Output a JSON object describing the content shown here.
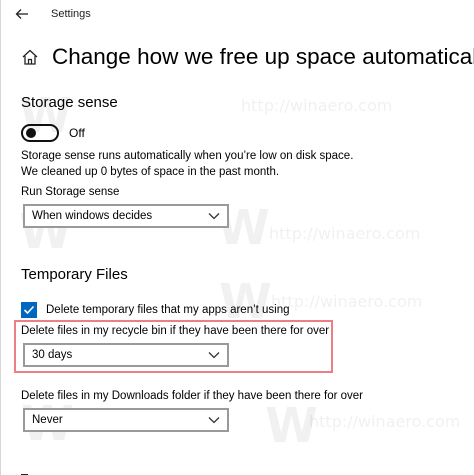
{
  "window": {
    "app_title": "Settings"
  },
  "header": {
    "title": "Change how we free up space automatically"
  },
  "storage_sense": {
    "section_title": "Storage sense",
    "toggle_state_label": "Off",
    "toggle_on": false,
    "description_line1": "Storage sense runs automatically when you’re low on disk space.",
    "description_line2": "We cleaned up 0 bytes of space in the past month.",
    "run_label": "Run Storage sense",
    "run_selected": "When windows decides"
  },
  "temporary_files": {
    "section_title": "Temporary Files",
    "delete_temp_label": "Delete temporary files that my apps aren’t using",
    "delete_temp_checked": true,
    "recycle_label": "Delete files in my recycle bin if they have been there for over",
    "recycle_selected": "30 days",
    "downloads_label": "Delete files in my Downloads folder if they have been there for over",
    "downloads_selected": "Never"
  },
  "watermark": {
    "text": "http://winaero.com",
    "letter": "W"
  },
  "colors": {
    "accent": "#0067c0",
    "highlight_border": "#f07d86",
    "select_border": "#9a9a9a"
  },
  "icons": {
    "back": "back-arrow-icon",
    "home": "home-icon",
    "dropdown": "chevron-down-icon",
    "check": "checkmark-icon"
  }
}
